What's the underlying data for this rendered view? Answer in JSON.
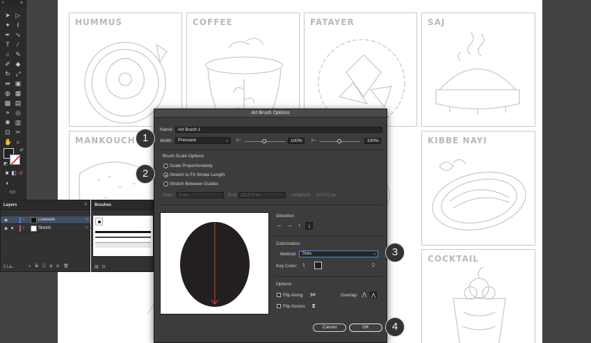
{
  "artboard": {
    "panels": [
      {
        "title": "HUMMUS"
      },
      {
        "title": "COFFEE"
      },
      {
        "title": "FATAYER"
      },
      {
        "title": "SAJ"
      },
      {
        "title": "MANKOUCHE"
      },
      {
        "title": "KIBBE NAYI"
      },
      {
        "title": "COCKTAIL"
      }
    ]
  },
  "layers_panel": {
    "tab": "Layers",
    "layers": [
      {
        "name": "Linework",
        "color": "#4a7fd6"
      },
      {
        "name": "Sketch",
        "color": "#e0566a"
      }
    ],
    "footer": "2 La..."
  },
  "brushes_panel": {
    "tab": "Brushes"
  },
  "dialog": {
    "title": "Art Brush Options",
    "name_label": "Name:",
    "name_value": "Art Brush 1",
    "width_label": "Width:",
    "width_value": "Pressure",
    "width_min": "100%",
    "width_max": "100%",
    "scale_section": "Brush Scale Options",
    "scale_options": [
      "Scale Proportionately",
      "Stretch to Fit Stroke Length",
      "Stretch Between Guides"
    ],
    "scale_selected": 1,
    "start_label": "Start:",
    "start_value": "0 px",
    "end_label": "End:",
    "end_value": "22.572 px",
    "length_label": "Length(X):",
    "length_value": "22.572 px",
    "direction_label": "Direction:",
    "colorization_label": "Colorization",
    "method_label": "Method:",
    "method_value": "Tints",
    "key_color_label": "Key Color:",
    "options_label": "Options",
    "flip_along": "Flip Along",
    "flip_across": "Flip Across",
    "overlap_label": "Overlap:",
    "cancel": "Cancel",
    "ok": "OK"
  },
  "steps": [
    "1",
    "2",
    "3",
    "4"
  ],
  "colors": {
    "accent": "#4a90d9",
    "preview_ellipse": "#231f20",
    "preview_arrow": "#e03a3a"
  }
}
